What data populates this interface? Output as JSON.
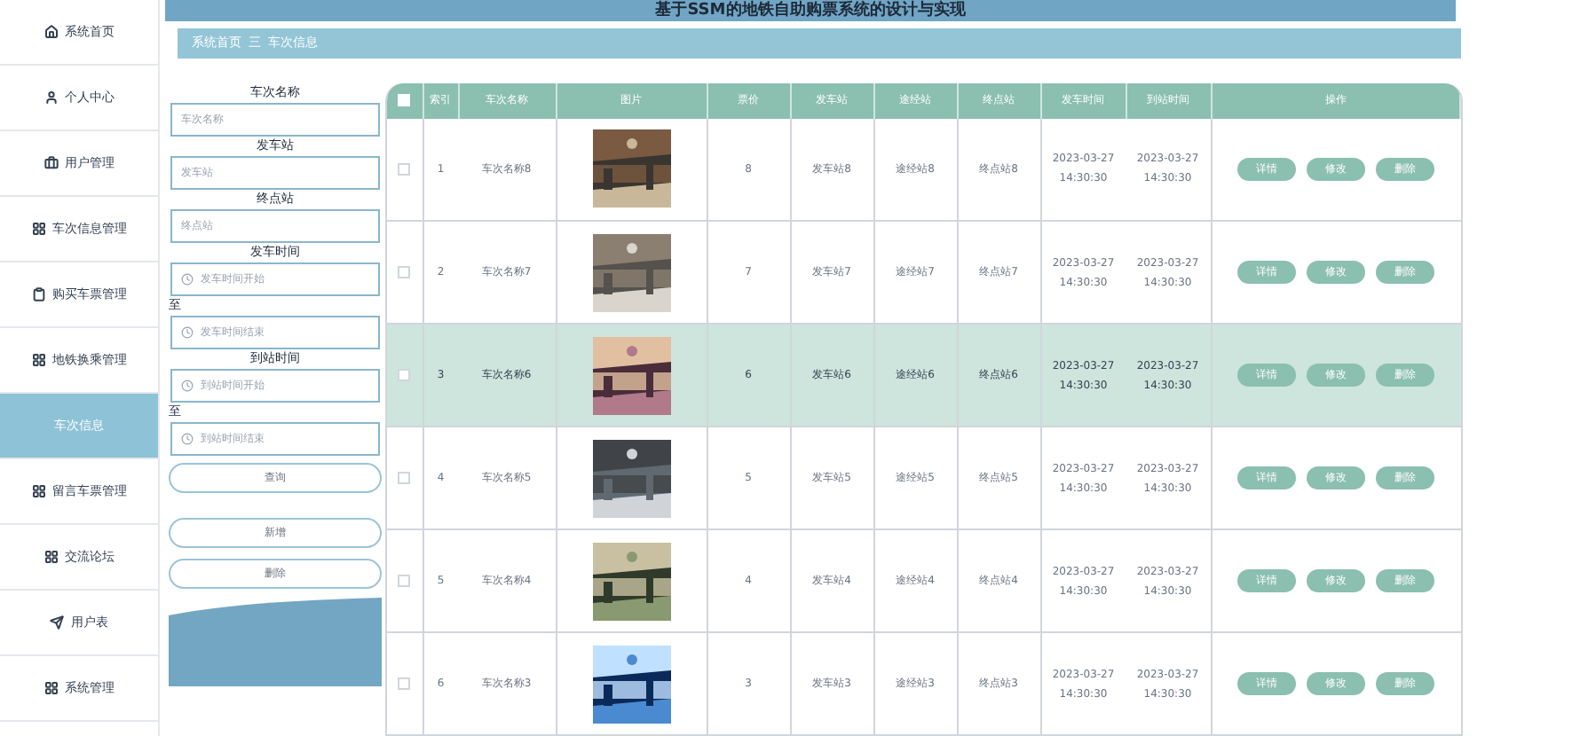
{
  "header": {
    "title": "基于SSM的地铁自助购票系统的设计与实现"
  },
  "sidebar": {
    "items": [
      {
        "label": "系统首页",
        "selected": false
      },
      {
        "label": "个人中心",
        "selected": false
      },
      {
        "label": "用户管理",
        "selected": false
      },
      {
        "label": "车次信息管理",
        "selected": false
      },
      {
        "label": "购买车票管理",
        "selected": false
      },
      {
        "label": "地铁换乘管理",
        "selected": false
      },
      {
        "label": "车次信息",
        "selected": true
      },
      {
        "label": "留言车票管理",
        "selected": false
      },
      {
        "label": "交流论坛",
        "selected": false
      },
      {
        "label": "用户表",
        "selected": false
      },
      {
        "label": "系统管理",
        "selected": false
      }
    ]
  },
  "breadcrumb": [
    "系统首页",
    "车次信息"
  ],
  "breadcrumb_separator": "三",
  "search": {
    "fields": [
      {
        "label": "车次名称",
        "placeholder": "车次名称",
        "kind": "text"
      },
      {
        "label": "发车站",
        "placeholder": "发车站",
        "kind": "text"
      },
      {
        "label": "终点站",
        "placeholder": "终点站",
        "kind": "text"
      },
      {
        "label": "发车时间",
        "placeholder": "发车时间开始",
        "kind": "time"
      },
      {
        "label": "至",
        "placeholder": "发车时间结束",
        "kind": "time"
      },
      {
        "label": "到站时间",
        "placeholder": "到站时间开始",
        "kind": "time"
      },
      {
        "label": "至",
        "placeholder": "到站时间结束",
        "kind": "time"
      }
    ],
    "buttons": [
      "查询",
      "新增",
      "删除"
    ]
  },
  "table": {
    "select_all": {
      "checked": false
    },
    "columns": [
      "索引",
      "车次名称",
      "图片",
      "票价",
      "发车站",
      "途经站",
      "终点站",
      "发车时间",
      "到站时间",
      "操作"
    ],
    "rows": [
      {
        "index": "1",
        "name": "车次名称8",
        "price": "8",
        "start": "发车站8",
        "via": "途经站8",
        "end": "终点站8",
        "depart": "2023-03-27 14:30:30",
        "arrive": "2023-03-27 14:30:30",
        "selected": false,
        "actions": [
          "详情",
          "修改",
          "删除"
        ]
      },
      {
        "index": "2",
        "name": "车次名称7",
        "price": "7",
        "start": "发车站7",
        "via": "途经站7",
        "end": "终点站7",
        "depart": "2023-03-27 14:30:30",
        "arrive": "2023-03-27 14:30:30",
        "selected": false,
        "actions": [
          "详情",
          "修改",
          "删除"
        ]
      },
      {
        "index": "3",
        "name": "车次名称6",
        "price": "6",
        "start": "发车站6",
        "via": "途经站6",
        "end": "终点站6",
        "depart": "2023-03-27 14:30:30",
        "arrive": "2023-03-27 14:30:30",
        "selected": true,
        "actions": [
          "详情",
          "修改",
          "删除"
        ]
      },
      {
        "index": "4",
        "name": "车次名称5",
        "price": "5",
        "start": "发车站5",
        "via": "途经站5",
        "end": "终点站5",
        "depart": "2023-03-27 14:30:30",
        "arrive": "2023-03-27 14:30:30",
        "selected": false,
        "actions": [
          "详情",
          "修改",
          "删除"
        ]
      },
      {
        "index": "5",
        "name": "车次名称4",
        "price": "4",
        "start": "发车站4",
        "via": "途经站4",
        "end": "终点站4",
        "depart": "2023-03-27 14:30:30",
        "arrive": "2023-03-27 14:30:30",
        "selected": false,
        "actions": [
          "详情",
          "修改",
          "删除"
        ]
      },
      {
        "index": "6",
        "name": "车次名称3",
        "price": "3",
        "start": "发车站3",
        "via": "途经站3",
        "end": "终点站3",
        "depart": "2023-03-27 14:30:30",
        "arrive": "2023-03-27 14:30:30",
        "selected": false,
        "actions": [
          "详情",
          "修改",
          "删除"
        ]
      }
    ]
  }
}
